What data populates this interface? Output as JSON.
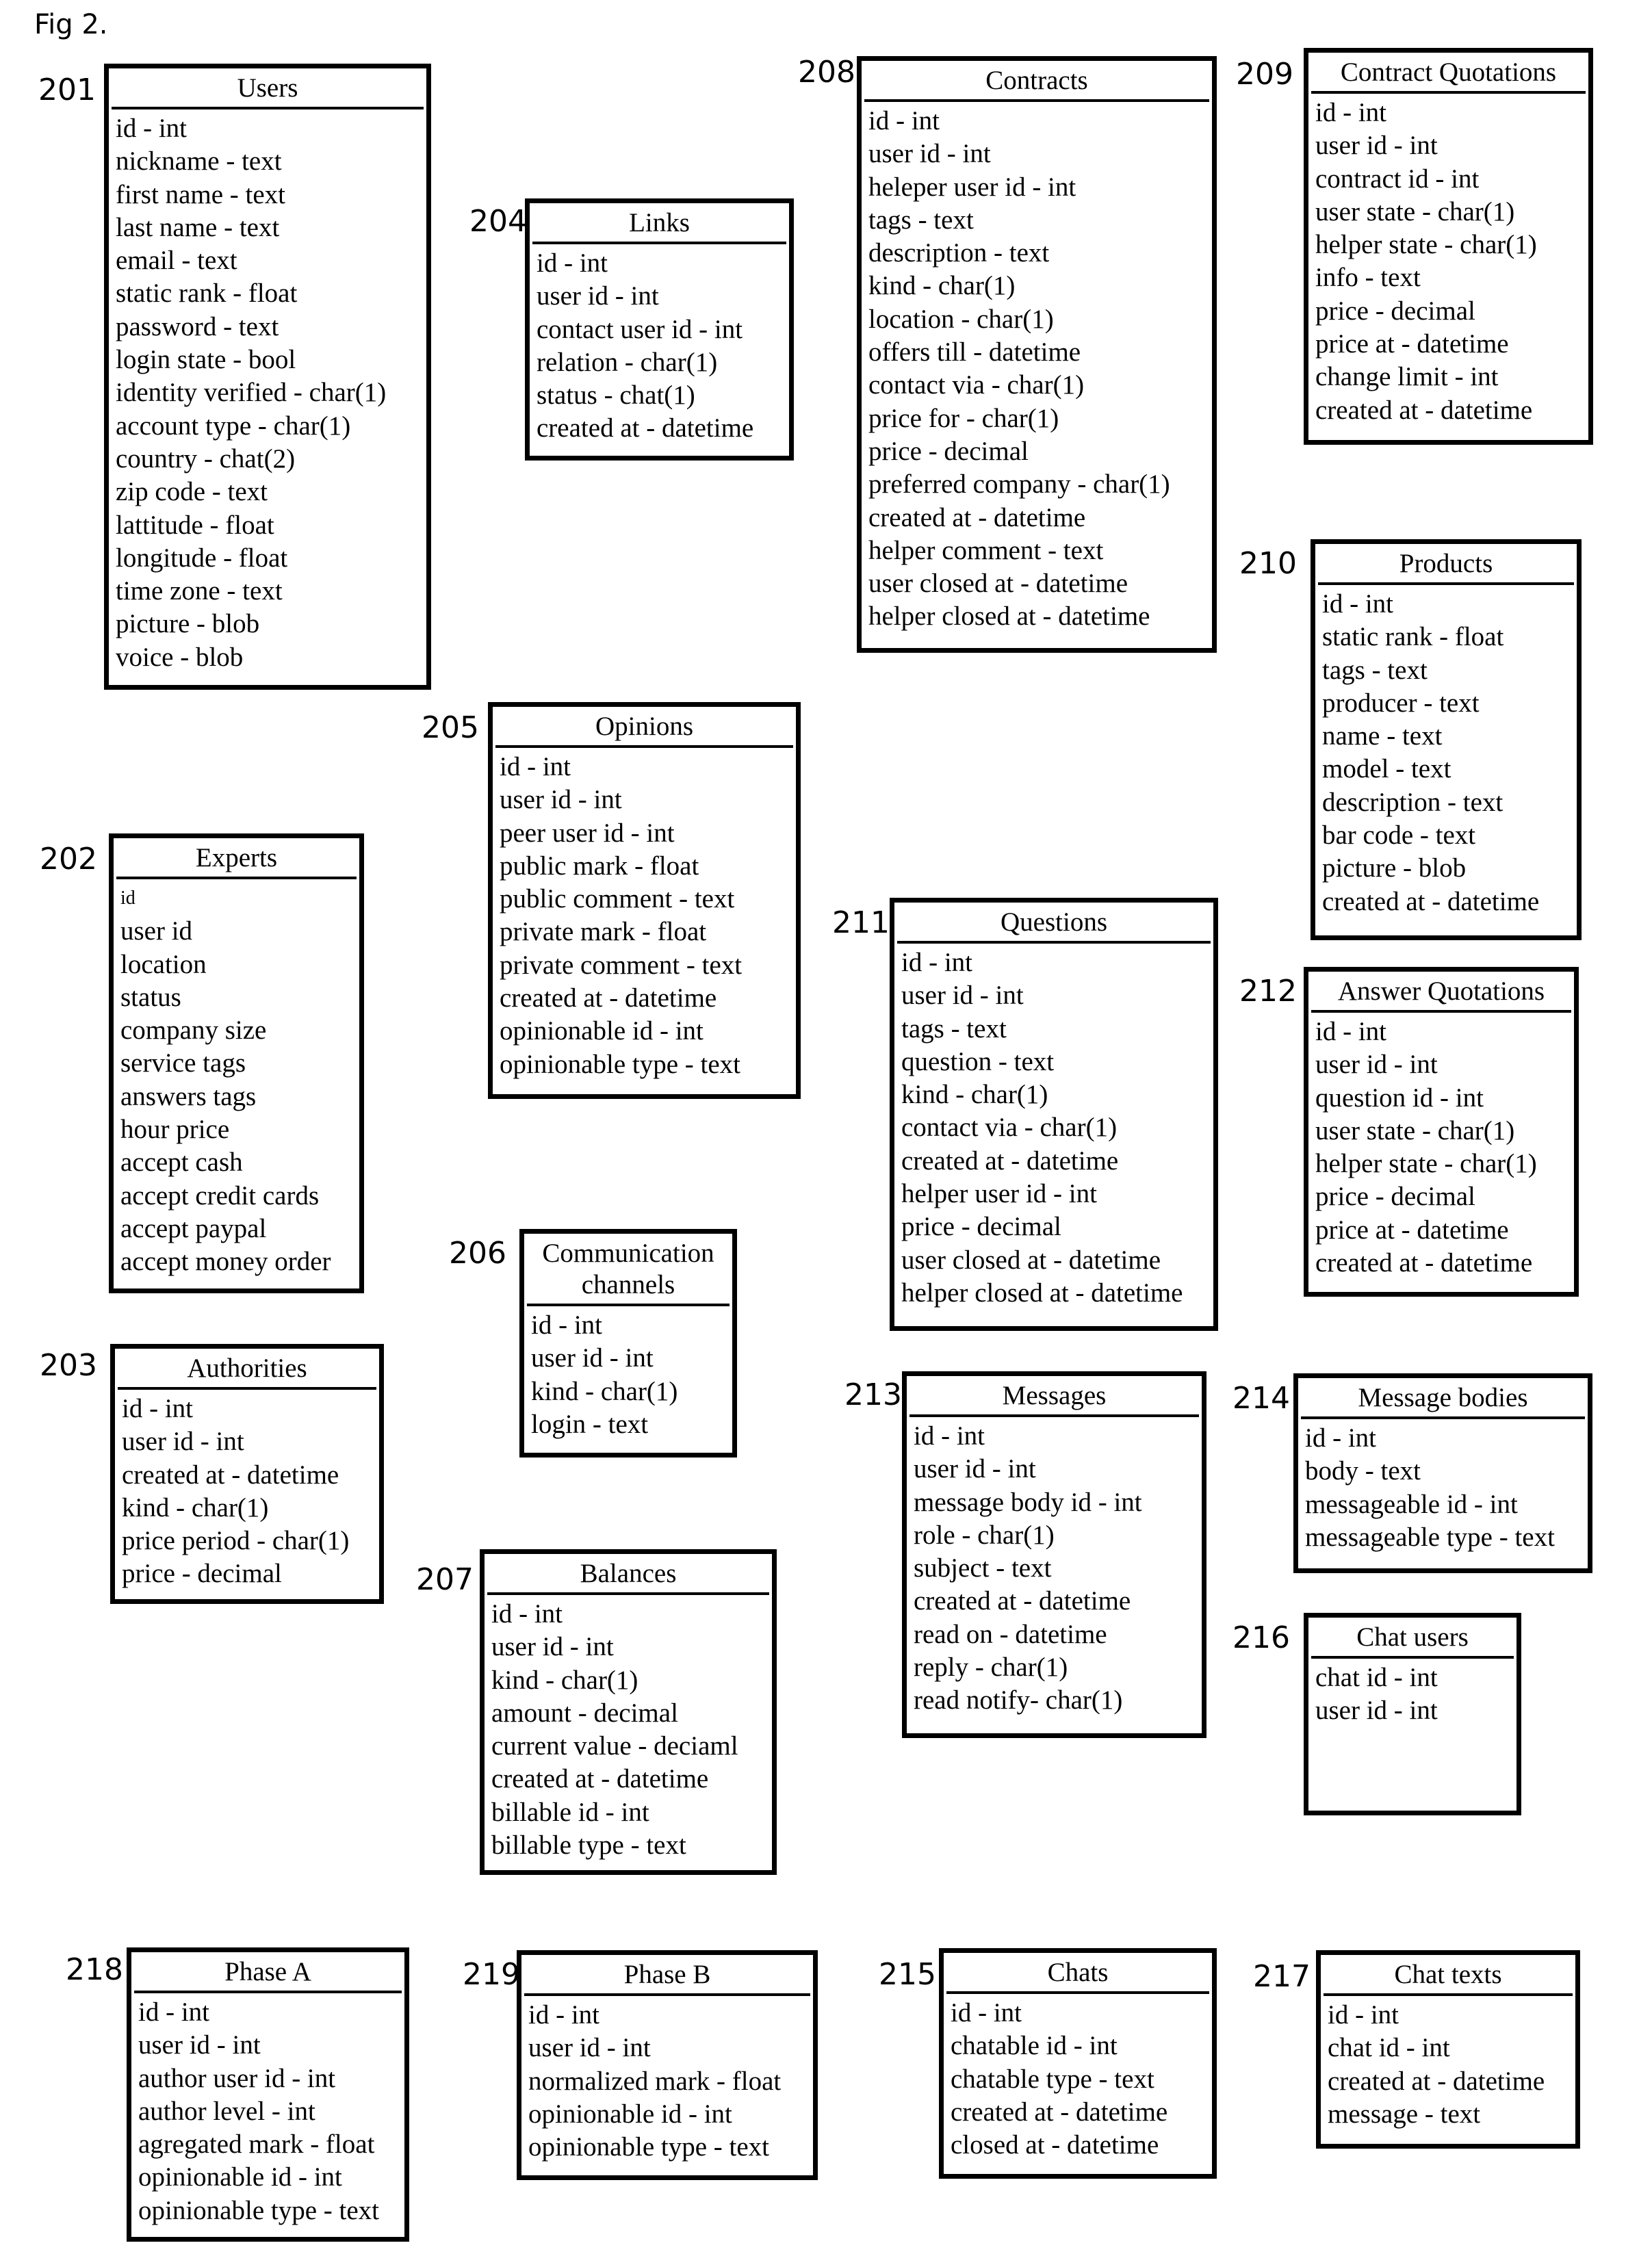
{
  "figure": {
    "label": "Fig 2."
  },
  "entities": {
    "users": {
      "ref": "201",
      "title": "Users",
      "fields": [
        "id - int",
        "nickname - text",
        "first name - text",
        "last name - text",
        "email - text",
        "static rank - float",
        "password - text",
        "login state - bool",
        "identity verified - char(1)",
        "account type - char(1)",
        "country - chat(2)",
        "zip code - text",
        "lattitude - float",
        "longitude - float",
        "time zone - text",
        "picture - blob",
        "voice - blob"
      ]
    },
    "experts": {
      "ref": "202",
      "title": "Experts",
      "fields": [
        "id",
        "user id",
        "location",
        "status",
        "company size",
        "service tags",
        "answers tags",
        "hour price",
        "accept cash",
        "accept credit cards",
        "accept paypal",
        "accept money order"
      ]
    },
    "authorities": {
      "ref": "203",
      "title": "Authorities",
      "fields": [
        "id - int",
        "user id - int",
        "created at - datetime",
        "kind - char(1)",
        "price period - char(1)",
        "price - decimal"
      ]
    },
    "links": {
      "ref": "204",
      "title": "Links",
      "fields": [
        "id - int",
        "user id - int",
        "contact user id - int",
        "relation - char(1)",
        "status - chat(1)",
        "created at - datetime"
      ]
    },
    "opinions": {
      "ref": "205",
      "title": "Opinions",
      "fields": [
        "id - int",
        "user id - int",
        "peer user id - int",
        "public mark - float",
        "public comment - text",
        "private mark - float",
        "private comment - text",
        "created at - datetime",
        "opinionable id - int",
        "opinionable type - text"
      ]
    },
    "communication_channels": {
      "ref": "206",
      "title_line1": "Communication",
      "title_line2": "channels",
      "fields": [
        "id - int",
        "user id - int",
        "kind - char(1)",
        "login - text"
      ]
    },
    "balances": {
      "ref": "207",
      "title": "Balances",
      "fields": [
        "id - int",
        "user id - int",
        "kind - char(1)",
        "amount - decimal",
        "current value - deciaml",
        "created at - datetime",
        "billable id - int",
        "billable type - text"
      ]
    },
    "contracts": {
      "ref": "208",
      "title": "Contracts",
      "fields": [
        "id - int",
        "user id - int",
        "heleper user id - int",
        "tags - text",
        "description - text",
        "kind - char(1)",
        "location - char(1)",
        "offers till - datetime",
        "contact via - char(1)",
        "price for - char(1)",
        "price - decimal",
        "preferred company - char(1)",
        "created at - datetime",
        "helper comment - text",
        "user closed at - datetime",
        "helper closed at - datetime"
      ]
    },
    "contract_quotations": {
      "ref": "209",
      "title": "Contract Quotations",
      "fields": [
        "id - int",
        "user id - int",
        "contract id - int",
        "user state - char(1)",
        "helper state - char(1)",
        "info - text",
        "price - decimal",
        "price at - datetime",
        "change limit - int",
        "created at - datetime"
      ]
    },
    "products": {
      "ref": "210",
      "title": "Products",
      "fields": [
        "id - int",
        "static rank - float",
        "tags - text",
        "producer - text",
        "name - text",
        "model - text",
        "description - text",
        "bar code - text",
        "picture - blob",
        "created at - datetime"
      ]
    },
    "questions": {
      "ref": "211",
      "title": "Questions",
      "fields": [
        "id - int",
        "user id - int",
        "tags - text",
        "question - text",
        "kind - char(1)",
        "contact via - char(1)",
        "created at - datetime",
        "helper user id - int",
        "price - decimal",
        "user closed at - datetime",
        "helper closed at - datetime"
      ]
    },
    "answer_quotations": {
      "ref": "212",
      "title": "Answer Quotations",
      "fields": [
        "id - int",
        "user id - int",
        "question id - int",
        "user state - char(1)",
        "helper state - char(1)",
        "price - decimal",
        "price at - datetime",
        "created at - datetime"
      ]
    },
    "messages": {
      "ref": "213",
      "title": "Messages",
      "fields": [
        "id - int",
        "user id - int",
        "message body id - int",
        "role - char(1)",
        "subject - text",
        "created at - datetime",
        "read on - datetime",
        "reply - char(1)",
        "read notify- char(1)"
      ]
    },
    "message_bodies": {
      "ref": "214",
      "title": "Message bodies",
      "fields": [
        "id - int",
        "body - text",
        "messageable id - int",
        "messageable type - text"
      ]
    },
    "chats": {
      "ref": "215",
      "title": "Chats",
      "fields": [
        "id - int",
        "chatable id - int",
        "chatable type - text",
        "created at - datetime",
        "closed at - datetime"
      ]
    },
    "chat_users": {
      "ref": "216",
      "title": "Chat users",
      "fields": [
        "chat id - int",
        "user id - int"
      ]
    },
    "chat_texts": {
      "ref": "217",
      "title": "Chat texts",
      "fields": [
        "id - int",
        "chat id - int",
        "created at - datetime",
        "message - text"
      ]
    },
    "phase_a": {
      "ref": "218",
      "title": "Phase A",
      "fields": [
        "id - int",
        "user id - int",
        "author user id - int",
        "author level - int",
        "agregated mark - float",
        "opinionable id - int",
        "opinionable type - text"
      ]
    },
    "phase_b": {
      "ref": "219",
      "title": "Phase B",
      "fields": [
        "id - int",
        "user id - int",
        "normalized mark - float",
        "opinionable id - int",
        "opinionable type - text"
      ]
    }
  }
}
